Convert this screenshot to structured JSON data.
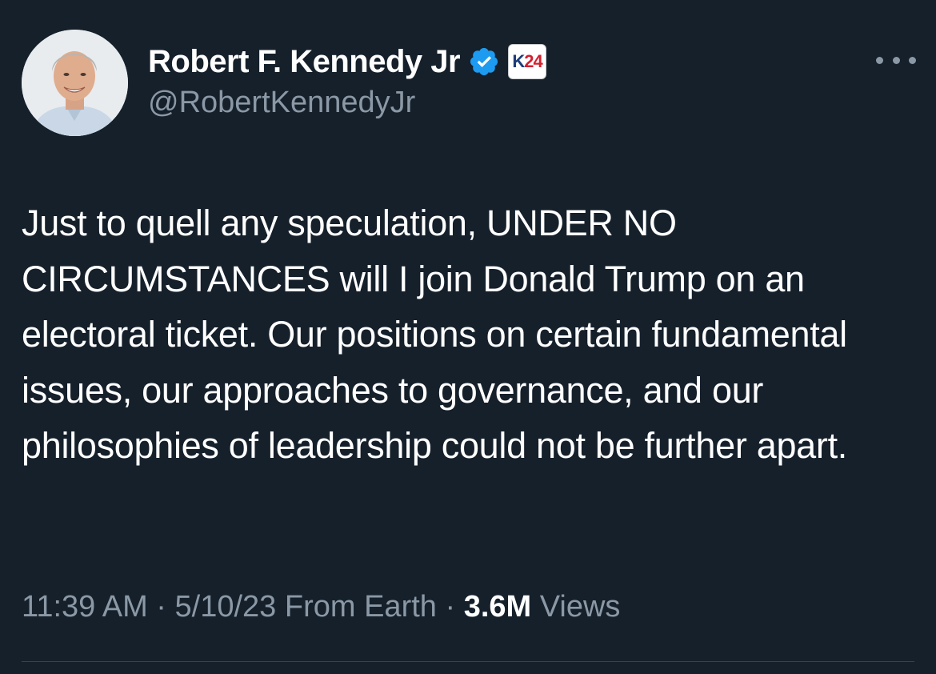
{
  "author": {
    "display_name": "Robert F. Kennedy Jr",
    "handle": "@RobertKennedyJr",
    "verified": true,
    "affiliate_badge": {
      "k": "K",
      "num": "24"
    },
    "avatar_icon": "profile-photo"
  },
  "menu": {
    "more_icon": "more-horizontal-icon"
  },
  "tweet": {
    "text": "Just to quell any speculation, UNDER NO CIRCUMSTANCES will I join Donald Trump on an electoral ticket. Our positions on certain fundamental issues, our approaches to governance, and our philosophies of leadership could not be further apart."
  },
  "meta": {
    "time": "11:39 AM",
    "separator": " · ",
    "date": "5/10/23",
    "source": "From Earth",
    "views_count": "3.6M",
    "views_label": "Views"
  },
  "colors": {
    "background": "#15202b",
    "text_primary": "#ffffff",
    "text_secondary": "#8b98a5",
    "verified_blue": "#1d9bf0",
    "divider": "#38444d"
  }
}
